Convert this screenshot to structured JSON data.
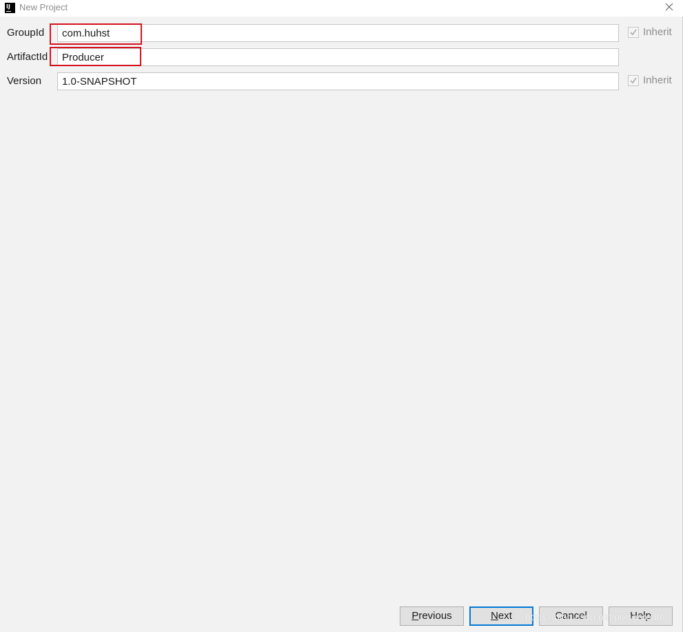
{
  "window": {
    "title": "New Project",
    "app_icon_text": "IJ"
  },
  "form": {
    "groupid": {
      "label": "GroupId",
      "value": "com.huhst"
    },
    "artifactid": {
      "label": "ArtifactId",
      "value": "Producer"
    },
    "version": {
      "label": "Version",
      "value": "1.0-SNAPSHOT"
    },
    "inherit_label": "Inherit",
    "groupid_inherit_checked": true,
    "version_inherit_checked": true
  },
  "buttons": {
    "previous": {
      "mnemonic": "P",
      "rest": "revious"
    },
    "next": {
      "mnemonic": "N",
      "rest": "ext"
    },
    "cancel": "Cancel",
    "help": "Help"
  },
  "watermark": "https://blog.csdn.net/poisonreate",
  "colors": {
    "highlight": "#d4101c",
    "default_button_border": "#0078d7",
    "background": "#f2f2f2"
  },
  "icons": {
    "close": "close-icon",
    "check": "checkmark-icon"
  }
}
